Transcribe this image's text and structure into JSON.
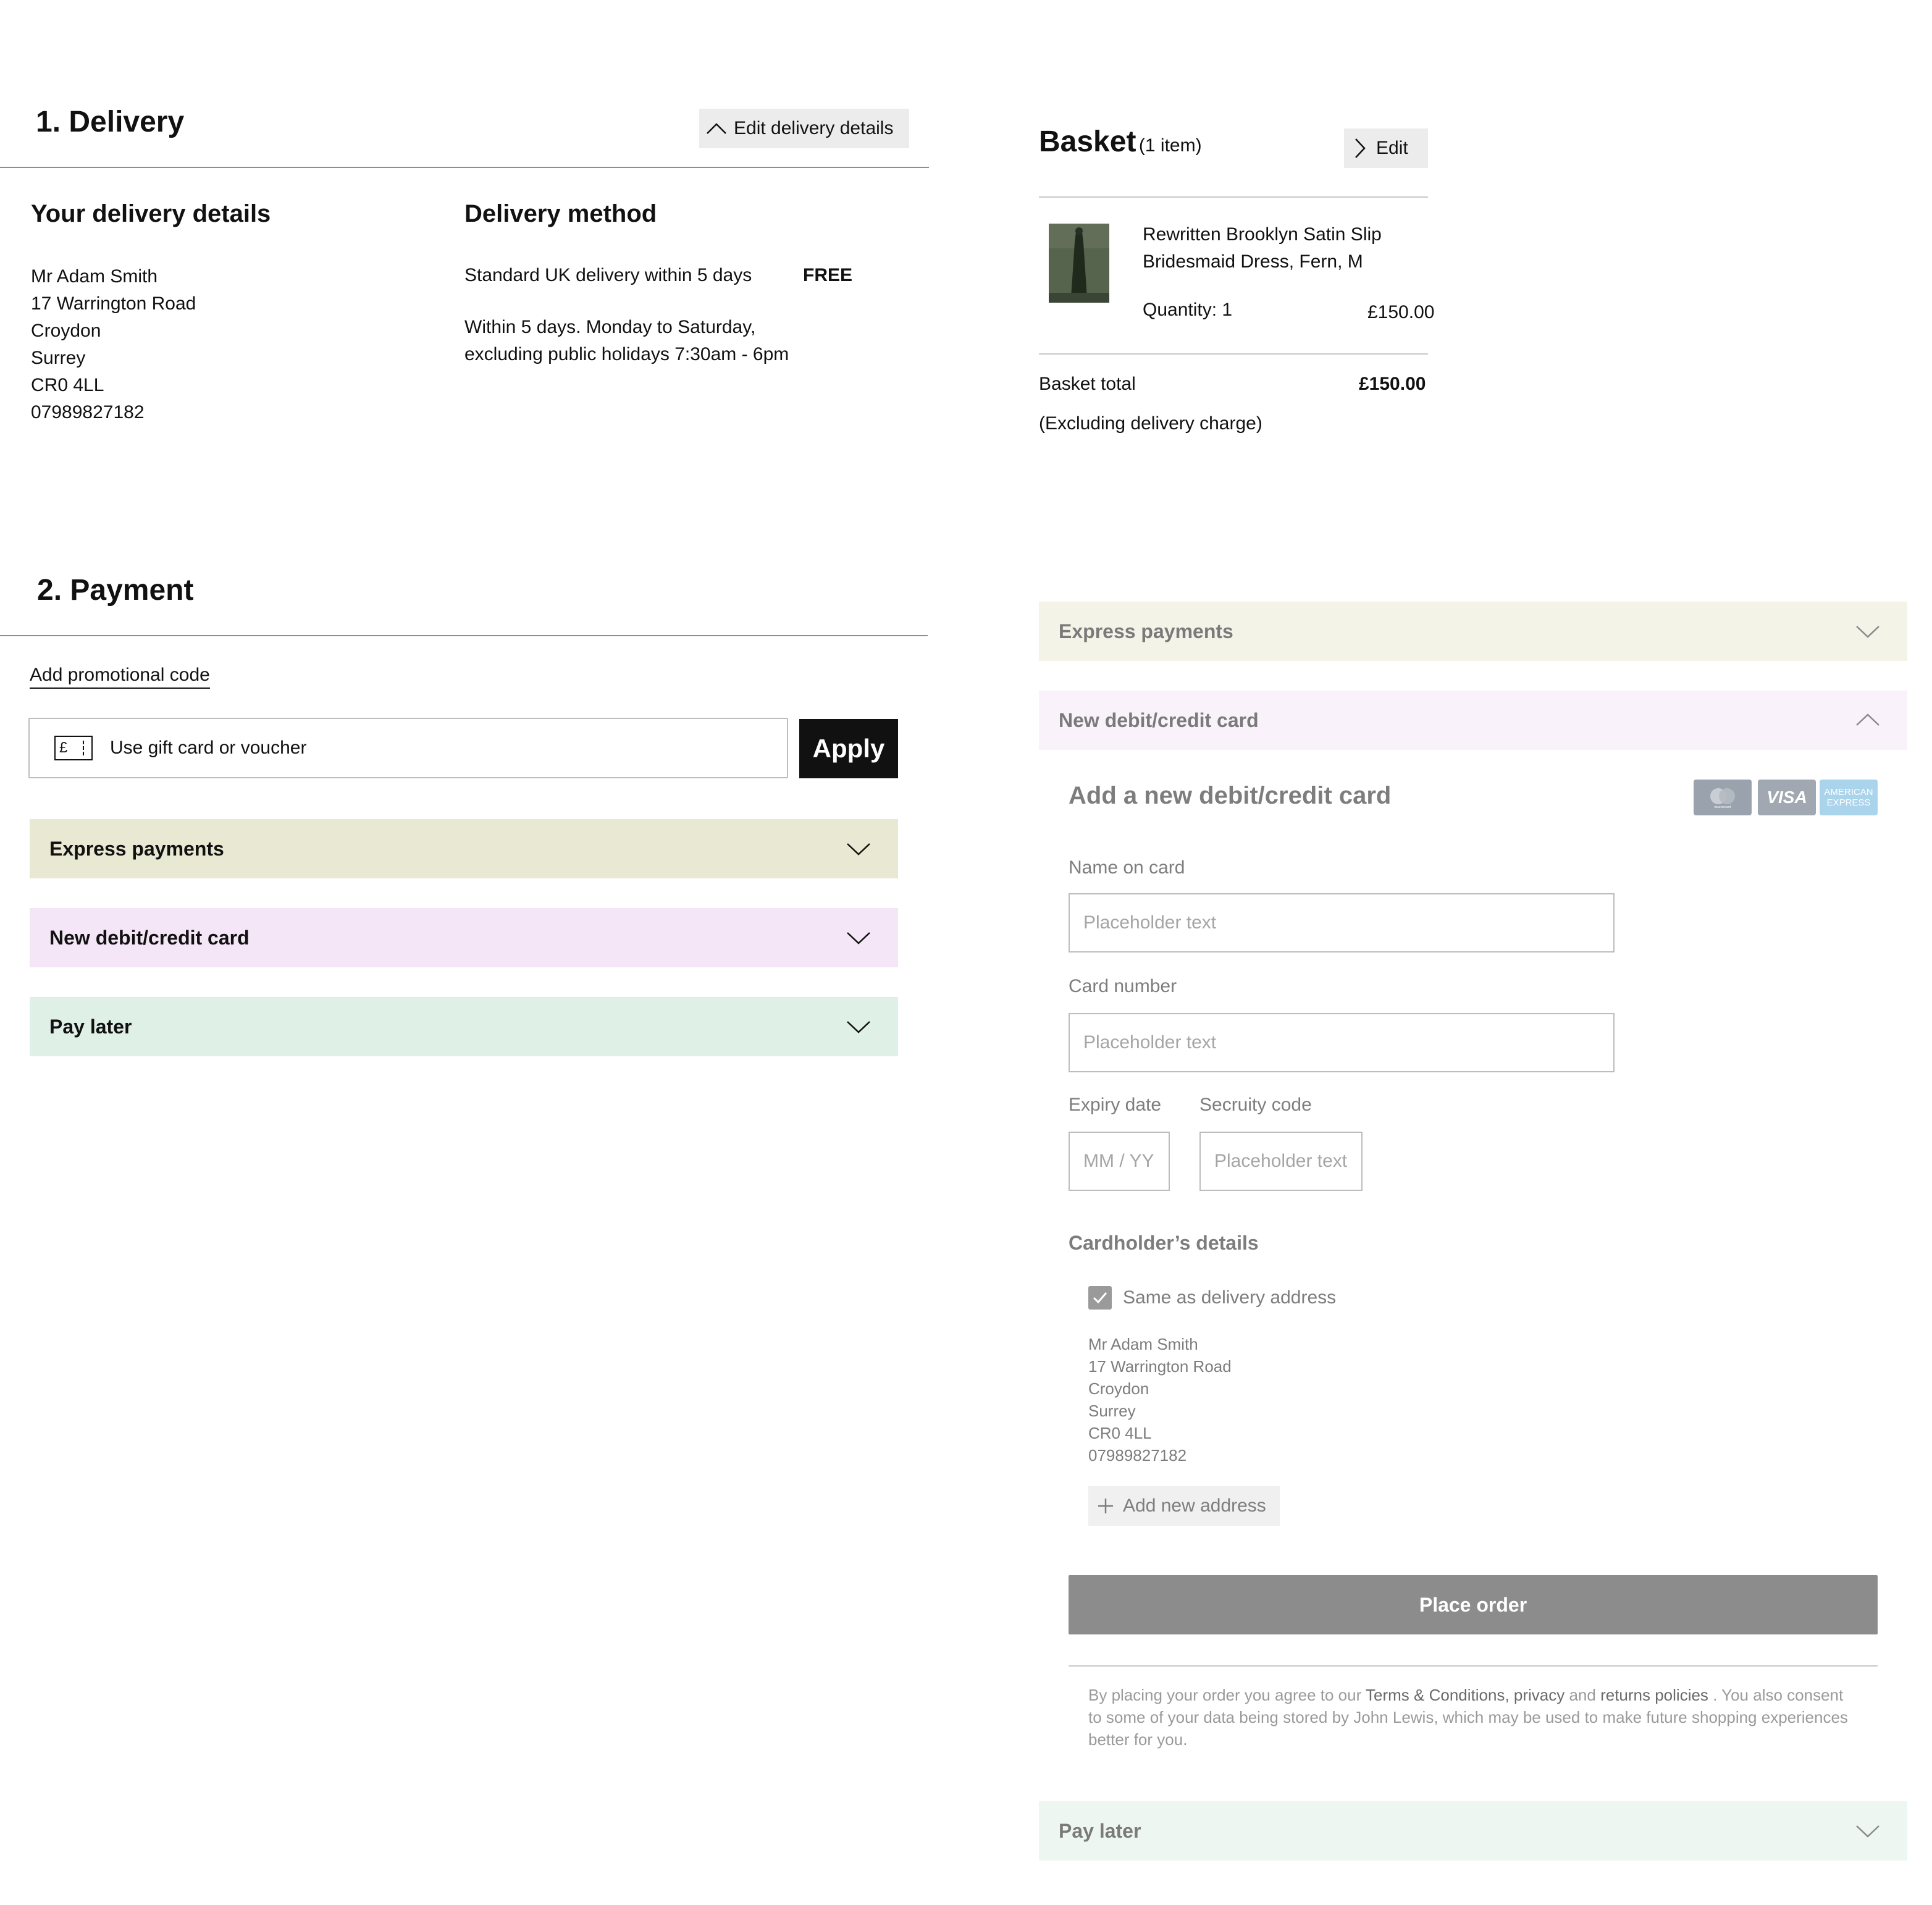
{
  "delivery": {
    "title": "1. Delivery",
    "edit_button": "Edit delivery details",
    "details_heading": "Your delivery details",
    "address": [
      "Mr Adam Smith",
      "17 Warrington Road",
      "Croydon",
      "Surrey",
      "CR0 4LL",
      "07989827182"
    ],
    "method_heading": "Delivery method",
    "method_name": "Standard UK delivery within 5 days",
    "method_price": "FREE",
    "method_note_1": "Within 5 days. Monday to Saturday,",
    "method_note_2": "excluding public holidays 7:30am - 6pm"
  },
  "basket": {
    "title": "Basket",
    "count": "(1 item)",
    "edit_button": "Edit",
    "item_name_1": "Rewritten Brooklyn Satin Slip",
    "item_name_2": "Bridesmaid Dress, Fern, M",
    "quantity": "Quantity: 1",
    "item_price": "£150.00",
    "total_label": "Basket total",
    "total_value": "£150.00",
    "total_note": "(Excluding delivery charge)"
  },
  "payment": {
    "title": "2. Payment",
    "promo_link": "Add promotional code",
    "voucher_placeholder": "Use gift card or voucher",
    "voucher_icon_glyph": "£",
    "apply_button": "Apply",
    "accordions": {
      "express": "Express payments",
      "card": "New debit/credit card",
      "later": "Pay later"
    },
    "colors": {
      "express_bg": "#e9e8d2",
      "card_bg": "#f4e6f6",
      "later_bg": "#dff0e7",
      "express_bg_light": "#f3f3e8",
      "card_bg_light": "#f9f2fa",
      "later_bg_light": "#eef6f1"
    }
  },
  "card_form": {
    "heading": "Add a new debit/credit card",
    "logos": {
      "mastercard": "mastercard",
      "visa": "VISA",
      "amex_1": "AMERICAN",
      "amex_2": "EXPRESS"
    },
    "name_label": "Name on card",
    "name_placeholder": "Placeholder text",
    "number_label": "Card number",
    "number_placeholder": "Placeholder text",
    "expiry_label": "Expiry date",
    "expiry_placeholder": "MM / YY",
    "security_label": "Secruity code",
    "security_placeholder": "Placeholder text",
    "cardholder_heading": "Cardholder’s details",
    "same_as_delivery": "Same as delivery address",
    "same_as_delivery_checked": true,
    "address": [
      "Mr Adam Smith",
      "17 Warrington Road",
      "Croydon",
      "Surrey",
      "CR0 4LL",
      "07989827182"
    ],
    "add_address": "Add new address",
    "place_order": "Place order",
    "legal": {
      "prefix": "By placing your order you agree to our ",
      "terms": "Terms & Conditions",
      "comma": ", ",
      "privacy": "privacy",
      "and": " and ",
      "returns": "returns policies",
      "rest": " . You also consent to some of your data being stored by John Lewis, which may be used to make future shopping experiences better for you."
    }
  }
}
